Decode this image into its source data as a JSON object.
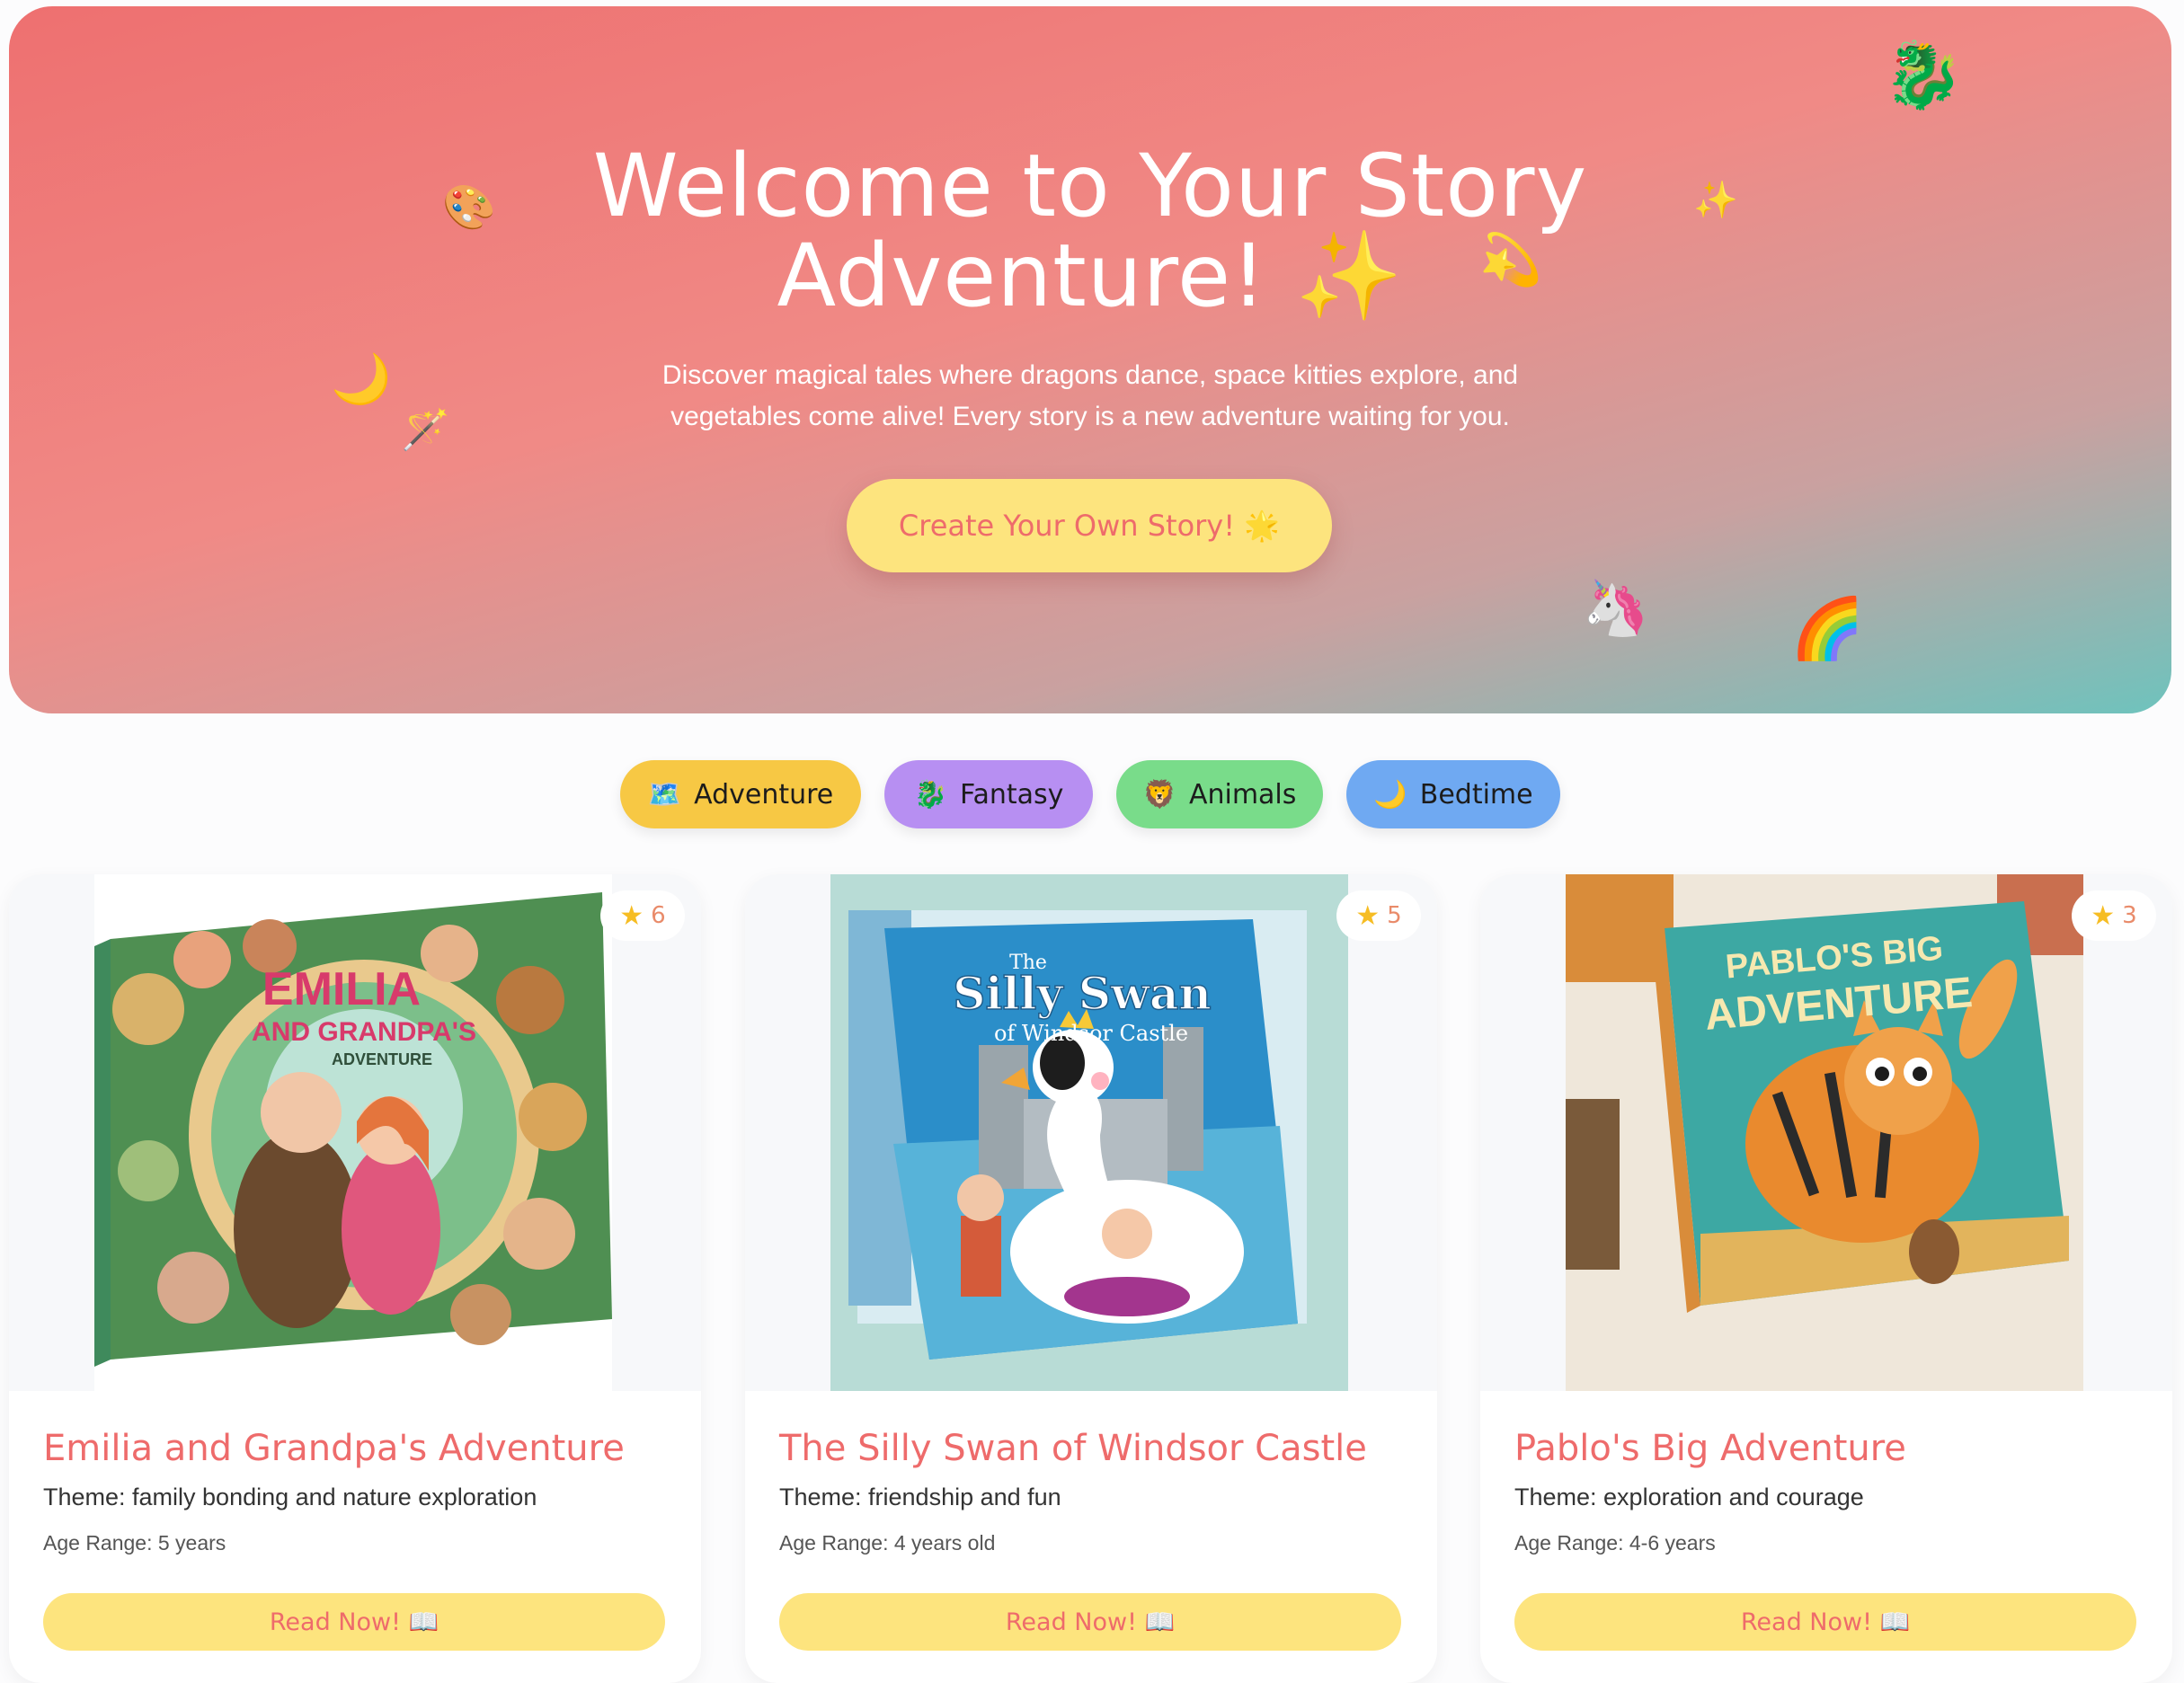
{
  "colors": {
    "hero_gradient_start": "#ee7070",
    "hero_gradient_end": "#6ec3bd",
    "accent_coral": "#ee6b6b",
    "button_yellow": "#fde47e",
    "adventure_pill": "#f7c844",
    "fantasy_pill": "#b78ff2",
    "animals_pill": "#79dc8a",
    "bedtime_pill": "#6fa9f2"
  },
  "hero": {
    "title_line1": "Welcome to Your Story",
    "title_line2": "Adventure! ✨",
    "subtitle_line1": "Discover magical tales where dragons dance, space kitties explore, and",
    "subtitle_line2": "vegetables come alive! Every story is a new adventure waiting for you.",
    "cta_label": "Create Your Own Story! 🌟",
    "decorations": [
      "🐉",
      "🎨",
      "✨",
      "💫",
      "🌙",
      "🪄",
      "🦄",
      "🌈"
    ]
  },
  "filters": [
    {
      "icon": "🗺️",
      "label": "Adventure"
    },
    {
      "icon": "🐉",
      "label": "Fantasy"
    },
    {
      "icon": "🦁",
      "label": "Animals"
    },
    {
      "icon": "🌙",
      "label": "Bedtime"
    }
  ],
  "stories": [
    {
      "title": "Emilia and Grandpa's Adventure",
      "theme": "Theme: family bonding and nature exploration",
      "age": "Age Range: 5 years",
      "rating": "6",
      "cover_line1": "EMILIA",
      "cover_line2": "AND GRANDPA'S",
      "cover_line3": "ADVENTURE",
      "read_label": "Read Now! 📖"
    },
    {
      "title": "The Silly Swan of Windsor Castle",
      "theme": "Theme: friendship and fun",
      "age": "Age Range: 4 years old",
      "rating": "5",
      "cover_line1": "The",
      "cover_line2": "Silly Swan",
      "cover_line3": "of Windsor Castle",
      "read_label": "Read Now! 📖"
    },
    {
      "title": "Pablo's Big Adventure",
      "theme": "Theme: exploration and courage",
      "age": "Age Range: 4-6 years",
      "rating": "3",
      "cover_line1": "PABLO'S BIG",
      "cover_line2": "ADVENTURE",
      "read_label": "Read Now! 📖"
    }
  ]
}
